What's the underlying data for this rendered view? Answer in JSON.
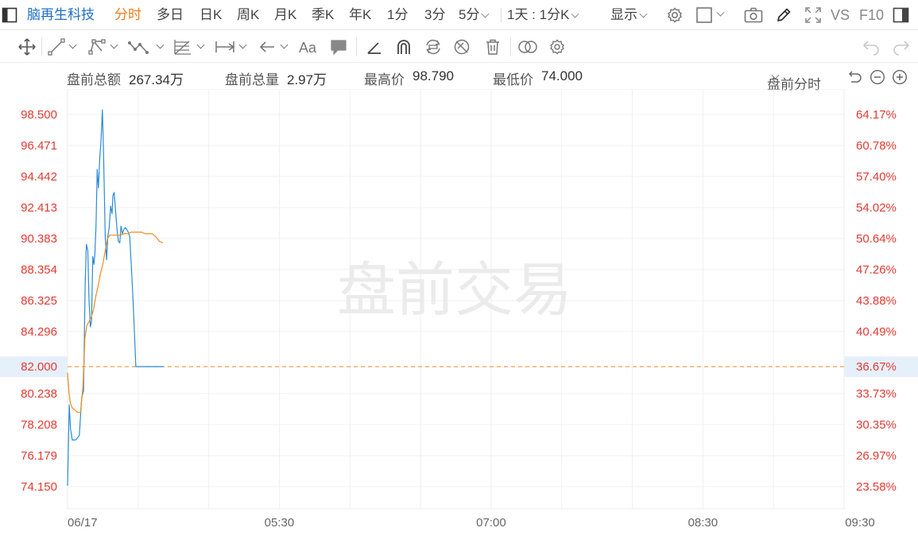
{
  "toolbar": {
    "stock_name": "脑再生科技",
    "periods": [
      {
        "label": "分时",
        "active": true
      },
      {
        "label": "多日"
      },
      {
        "label": "日K"
      },
      {
        "label": "周K"
      },
      {
        "label": "月K"
      },
      {
        "label": "季K"
      },
      {
        "label": "年K"
      },
      {
        "label": "1分"
      },
      {
        "label": "3分"
      },
      {
        "label": "5分"
      }
    ],
    "range_label": "1天 : 1分K",
    "display_label": "显示",
    "vs_label": "VS",
    "f10_label": "F10"
  },
  "info": {
    "total_amount_label": "盘前总额",
    "total_amount_value": "267.34万",
    "total_volume_label": "盘前总量",
    "total_volume_value": "2.97万",
    "high_label": "最高价",
    "high_value": "98.790",
    "low_label": "最低价",
    "low_value": "74.000",
    "mode_label": "盘前分时"
  },
  "chart_data": {
    "type": "line",
    "watermark": "盘前交易",
    "base_price": 82.0,
    "base_price_label": "82.000",
    "base_percent_label": "36.67%",
    "y_left_ticks": [
      "98.500",
      "96.471",
      "94.442",
      "92.413",
      "90.383",
      "88.354",
      "86.325",
      "84.296",
      "82.000",
      "80.238",
      "78.208",
      "76.179",
      "74.150"
    ],
    "y_left_values": [
      98.5,
      96.471,
      94.442,
      92.413,
      90.383,
      88.354,
      86.325,
      84.296,
      82.0,
      80.238,
      78.208,
      76.179,
      74.15
    ],
    "y_right_ticks": [
      "64.17%",
      "60.78%",
      "57.40%",
      "54.02%",
      "50.64%",
      "47.26%",
      "43.88%",
      "40.49%",
      "36.67%",
      "33.73%",
      "30.35%",
      "26.97%",
      "23.58%"
    ],
    "ylim": [
      74.15,
      98.5
    ],
    "x_ticks": [
      "06/17",
      "05:30",
      "07:00",
      "08:30",
      "09:30"
    ],
    "x_tick_minutes": [
      0,
      90,
      180,
      270,
      330
    ],
    "x_range_minutes": [
      0,
      330
    ],
    "series": [
      {
        "color": "#2a8bd8",
        "x": [
          0,
          0.7,
          1.3,
          2,
          2.6,
          3.3,
          4,
          5,
          6,
          6.8,
          7.5,
          8,
          8.6,
          9.1,
          9.7,
          10.2,
          10.7,
          11.2,
          11.6,
          12.1,
          12.6,
          13.1,
          13.7,
          14.2,
          14.8,
          15.3,
          16,
          16.6,
          17.1,
          17.7,
          18.3,
          18.9,
          19.3,
          19.8,
          20.4,
          21,
          21.6,
          22.2,
          22.7,
          23.3,
          24,
          24.5,
          25.1,
          25.8,
          26.4,
          27,
          27.7,
          28.4,
          29,
          29.6,
          30.3,
          31,
          31.7,
          32.4,
          33,
          33.6,
          34.2,
          34.9,
          35.5,
          36.1,
          36.8,
          37.5,
          38.1,
          38.7,
          39.3,
          40,
          40.8
        ],
        "values": [
          74.2,
          79.5,
          77.9,
          77.2,
          77.2,
          77.2,
          77.3,
          77.5,
          80.0,
          80.4,
          87.5,
          90.0,
          89.6,
          86.5,
          84.6,
          85.0,
          89.2,
          88.7,
          89.3,
          91.2,
          94.9,
          93.7,
          95.7,
          96.7,
          98.8,
          95.9,
          90.5,
          89.0,
          90.5,
          91.1,
          92.5,
          92.0,
          93.2,
          93.4,
          92.2,
          91.0,
          90.2,
          90.1,
          91.2,
          90.7,
          91.0,
          91.1,
          91.0,
          90.8,
          90.5,
          88.9,
          86.8,
          84.3,
          82.0,
          82.0,
          82.0,
          82.0,
          82.0,
          82.0,
          82.0,
          82.0,
          82.0,
          82.0,
          82.0,
          82.0,
          82.0,
          82.0,
          82.0,
          82.0,
          82.0,
          82.0,
          82.0
        ]
      },
      {
        "color": "#f08a1c",
        "x": [
          0,
          0.6,
          1.2,
          2,
          2.8,
          3.6,
          4.5,
          5.5,
          6.6,
          7.4,
          8.2,
          9,
          10,
          11,
          12,
          13,
          14,
          15,
          16,
          17,
          18,
          19.5,
          21,
          22.5,
          24,
          25.5,
          27,
          28.5,
          30,
          31.5,
          33,
          34.5,
          36,
          37.5,
          39,
          40.5
        ],
        "values": [
          81.6,
          80.3,
          79.6,
          79.3,
          79.2,
          79.1,
          79.0,
          79.0,
          80.8,
          83.9,
          84.7,
          84.9,
          85.2,
          85.7,
          86.6,
          87.3,
          88.1,
          88.7,
          89.6,
          90.4,
          90.6,
          90.6,
          90.6,
          90.6,
          90.7,
          90.7,
          90.8,
          90.8,
          90.8,
          90.8,
          90.7,
          90.7,
          90.7,
          90.5,
          90.2,
          90.1
        ]
      }
    ]
  }
}
